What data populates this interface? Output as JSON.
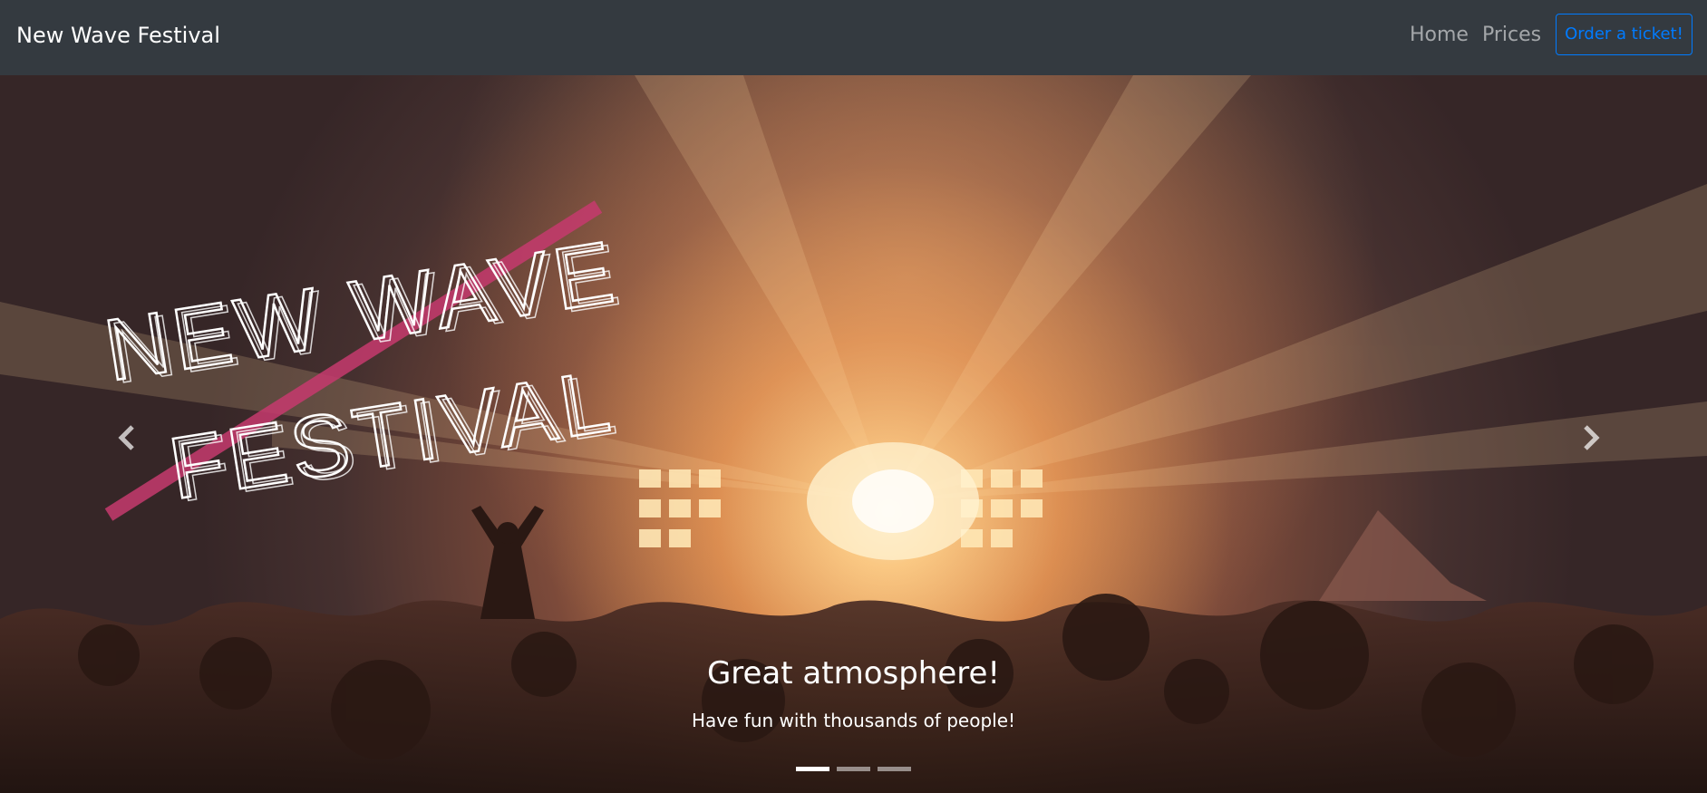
{
  "navbar": {
    "brand": "New Wave Festival",
    "links": [
      "Home",
      "Prices"
    ],
    "cta": "Order a ticket!"
  },
  "hero": {
    "logo_line1": "NEW WAVE",
    "logo_line2": "FESTIVAL",
    "logo_accent": "#c63a6e",
    "slide_title": "Great atmosphere!",
    "slide_subtitle": "Have fun with thousands of people!",
    "slides_total": 3,
    "active_slide": 1
  },
  "colors": {
    "navbar_bg": "#343a40",
    "cta": "#007bff"
  }
}
